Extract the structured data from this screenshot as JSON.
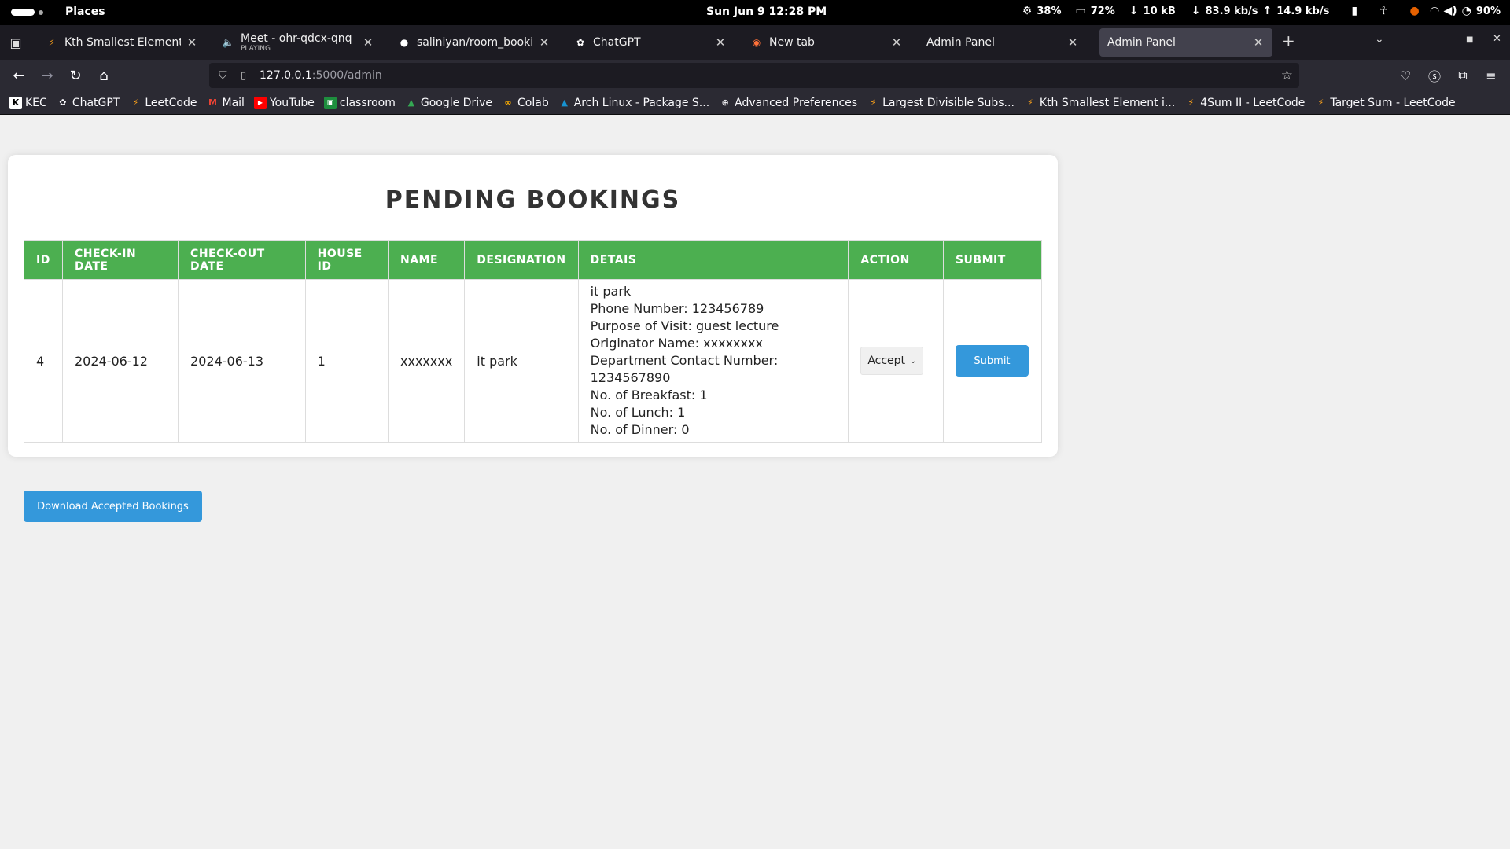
{
  "system": {
    "places": "Places",
    "clock": "Sun Jun 9  12:28 PM",
    "cpu": "38%",
    "mem": "72%",
    "disk": "10 kB",
    "down": "83.9 kb/s",
    "up": "14.9 kb/s",
    "battery": "90%"
  },
  "tabs": [
    {
      "title": "Kth Smallest Element in a",
      "icon": "leetcode-icon",
      "active": false
    },
    {
      "title": "Meet - ohr-qdcx-qnq",
      "sub": "PLAYING",
      "icon": "speaker-icon",
      "active": false
    },
    {
      "title": "saliniyan/room_booking",
      "icon": "github-icon",
      "active": false
    },
    {
      "title": "ChatGPT",
      "icon": "chatgpt-icon",
      "active": false
    },
    {
      "title": "New tab",
      "icon": "firefox-icon",
      "active": false
    },
    {
      "title": "Admin Panel",
      "icon": "",
      "active": false
    },
    {
      "title": "Admin Panel",
      "icon": "",
      "active": true
    }
  ],
  "url": {
    "host": "127.0.0.1",
    "path": ":5000/admin"
  },
  "bookmarks": [
    {
      "label": "KEC",
      "icon": "kec-icon"
    },
    {
      "label": "ChatGPT",
      "icon": "chatgpt-icon"
    },
    {
      "label": "LeetCode",
      "icon": "leetcode-icon"
    },
    {
      "label": "Mail",
      "icon": "gmail-icon"
    },
    {
      "label": "YouTube",
      "icon": "youtube-icon"
    },
    {
      "label": "classroom",
      "icon": "classroom-icon"
    },
    {
      "label": "Google Drive",
      "icon": "drive-icon"
    },
    {
      "label": "Colab",
      "icon": "colab-icon"
    },
    {
      "label": "Arch Linux - Package S...",
      "icon": "arch-icon"
    },
    {
      "label": "Advanced Preferences",
      "icon": "globe-icon"
    },
    {
      "label": "Largest Divisible Subs...",
      "icon": "leetcode-icon"
    },
    {
      "label": "Kth Smallest Element i...",
      "icon": "leetcode-icon"
    },
    {
      "label": "4Sum II - LeetCode",
      "icon": "leetcode-icon"
    },
    {
      "label": "Target Sum - LeetCode",
      "icon": "leetcode-icon"
    }
  ],
  "page": {
    "title": "PENDING BOOKINGS",
    "columns": [
      "ID",
      "Check-in Date",
      "Check-out Date",
      "House ID",
      "Name",
      "Designation",
      "Detais",
      "Action",
      "Submit"
    ],
    "row": {
      "id": "4",
      "checkin": "2024-06-12",
      "checkout": "2024-06-13",
      "house_id": "1",
      "name": "xxxxxxx",
      "designation": "it park",
      "details": [
        "it park",
        "Phone Number: 123456789",
        "Purpose of Visit: guest lecture",
        "Originator Name: xxxxxxxx",
        "Department Contact Number: 1234567890",
        "No. of Breakfast: 1",
        "No. of Lunch: 1",
        "No. of Dinner: 0"
      ],
      "action_selected": "Accept",
      "submit_label": "Submit"
    },
    "download_label": "Download Accepted Bookings",
    "colors": {
      "header_green": "#4caf50",
      "button_blue": "#3498db"
    }
  }
}
